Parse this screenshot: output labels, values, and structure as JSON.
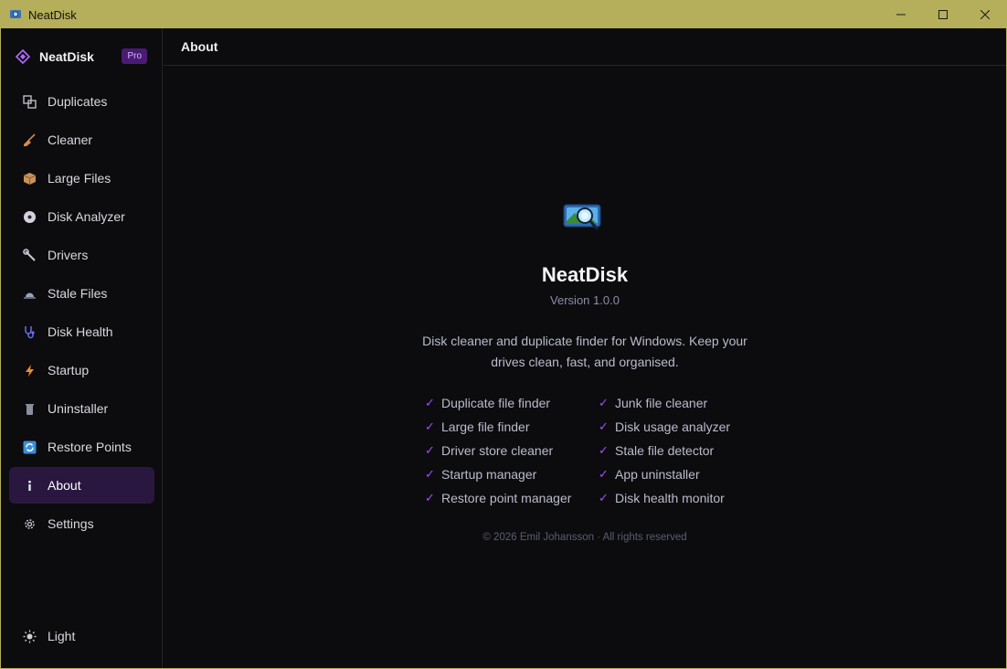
{
  "window": {
    "title": "NeatDisk",
    "controls": [
      "minimize-icon",
      "maximize-icon",
      "close-icon"
    ]
  },
  "sidebar": {
    "brand_name": "NeatDisk",
    "badge": "Pro",
    "items": [
      {
        "label": "Duplicates",
        "icon": "duplicates-icon"
      },
      {
        "label": "Cleaner",
        "icon": "broom-icon"
      },
      {
        "label": "Large Files",
        "icon": "package-icon"
      },
      {
        "label": "Disk Analyzer",
        "icon": "disc-icon"
      },
      {
        "label": "Drivers",
        "icon": "wrench-icon"
      },
      {
        "label": "Stale Files",
        "icon": "sunset-icon"
      },
      {
        "label": "Disk Health",
        "icon": "stethoscope-icon"
      },
      {
        "label": "Startup",
        "icon": "lightning-icon"
      },
      {
        "label": "Uninstaller",
        "icon": "trash-icon"
      },
      {
        "label": "Restore Points",
        "icon": "refresh-icon"
      },
      {
        "label": "About",
        "icon": "info-icon",
        "active": true
      },
      {
        "label": "Settings",
        "icon": "gear-icon"
      }
    ],
    "theme_label": "Light"
  },
  "header": {
    "title": "About"
  },
  "about": {
    "app_name": "NeatDisk",
    "version": "Version 1.0.0",
    "description": "Disk cleaner and duplicate finder for Windows. Keep your drives clean, fast, and organised.",
    "features": [
      "Duplicate file finder",
      "Junk file cleaner",
      "Large file finder",
      "Disk usage analyzer",
      "Driver store cleaner",
      "Stale file detector",
      "Startup manager",
      "App uninstaller",
      "Restore point manager",
      "Disk health monitor"
    ],
    "check_mark": "✓",
    "copyright": "© 2026 Emil Johansson · All rights reserved"
  },
  "colors": {
    "accent": "#a04cff",
    "titlebar": "#b5ae5a",
    "active_bg": "#2a1740"
  }
}
